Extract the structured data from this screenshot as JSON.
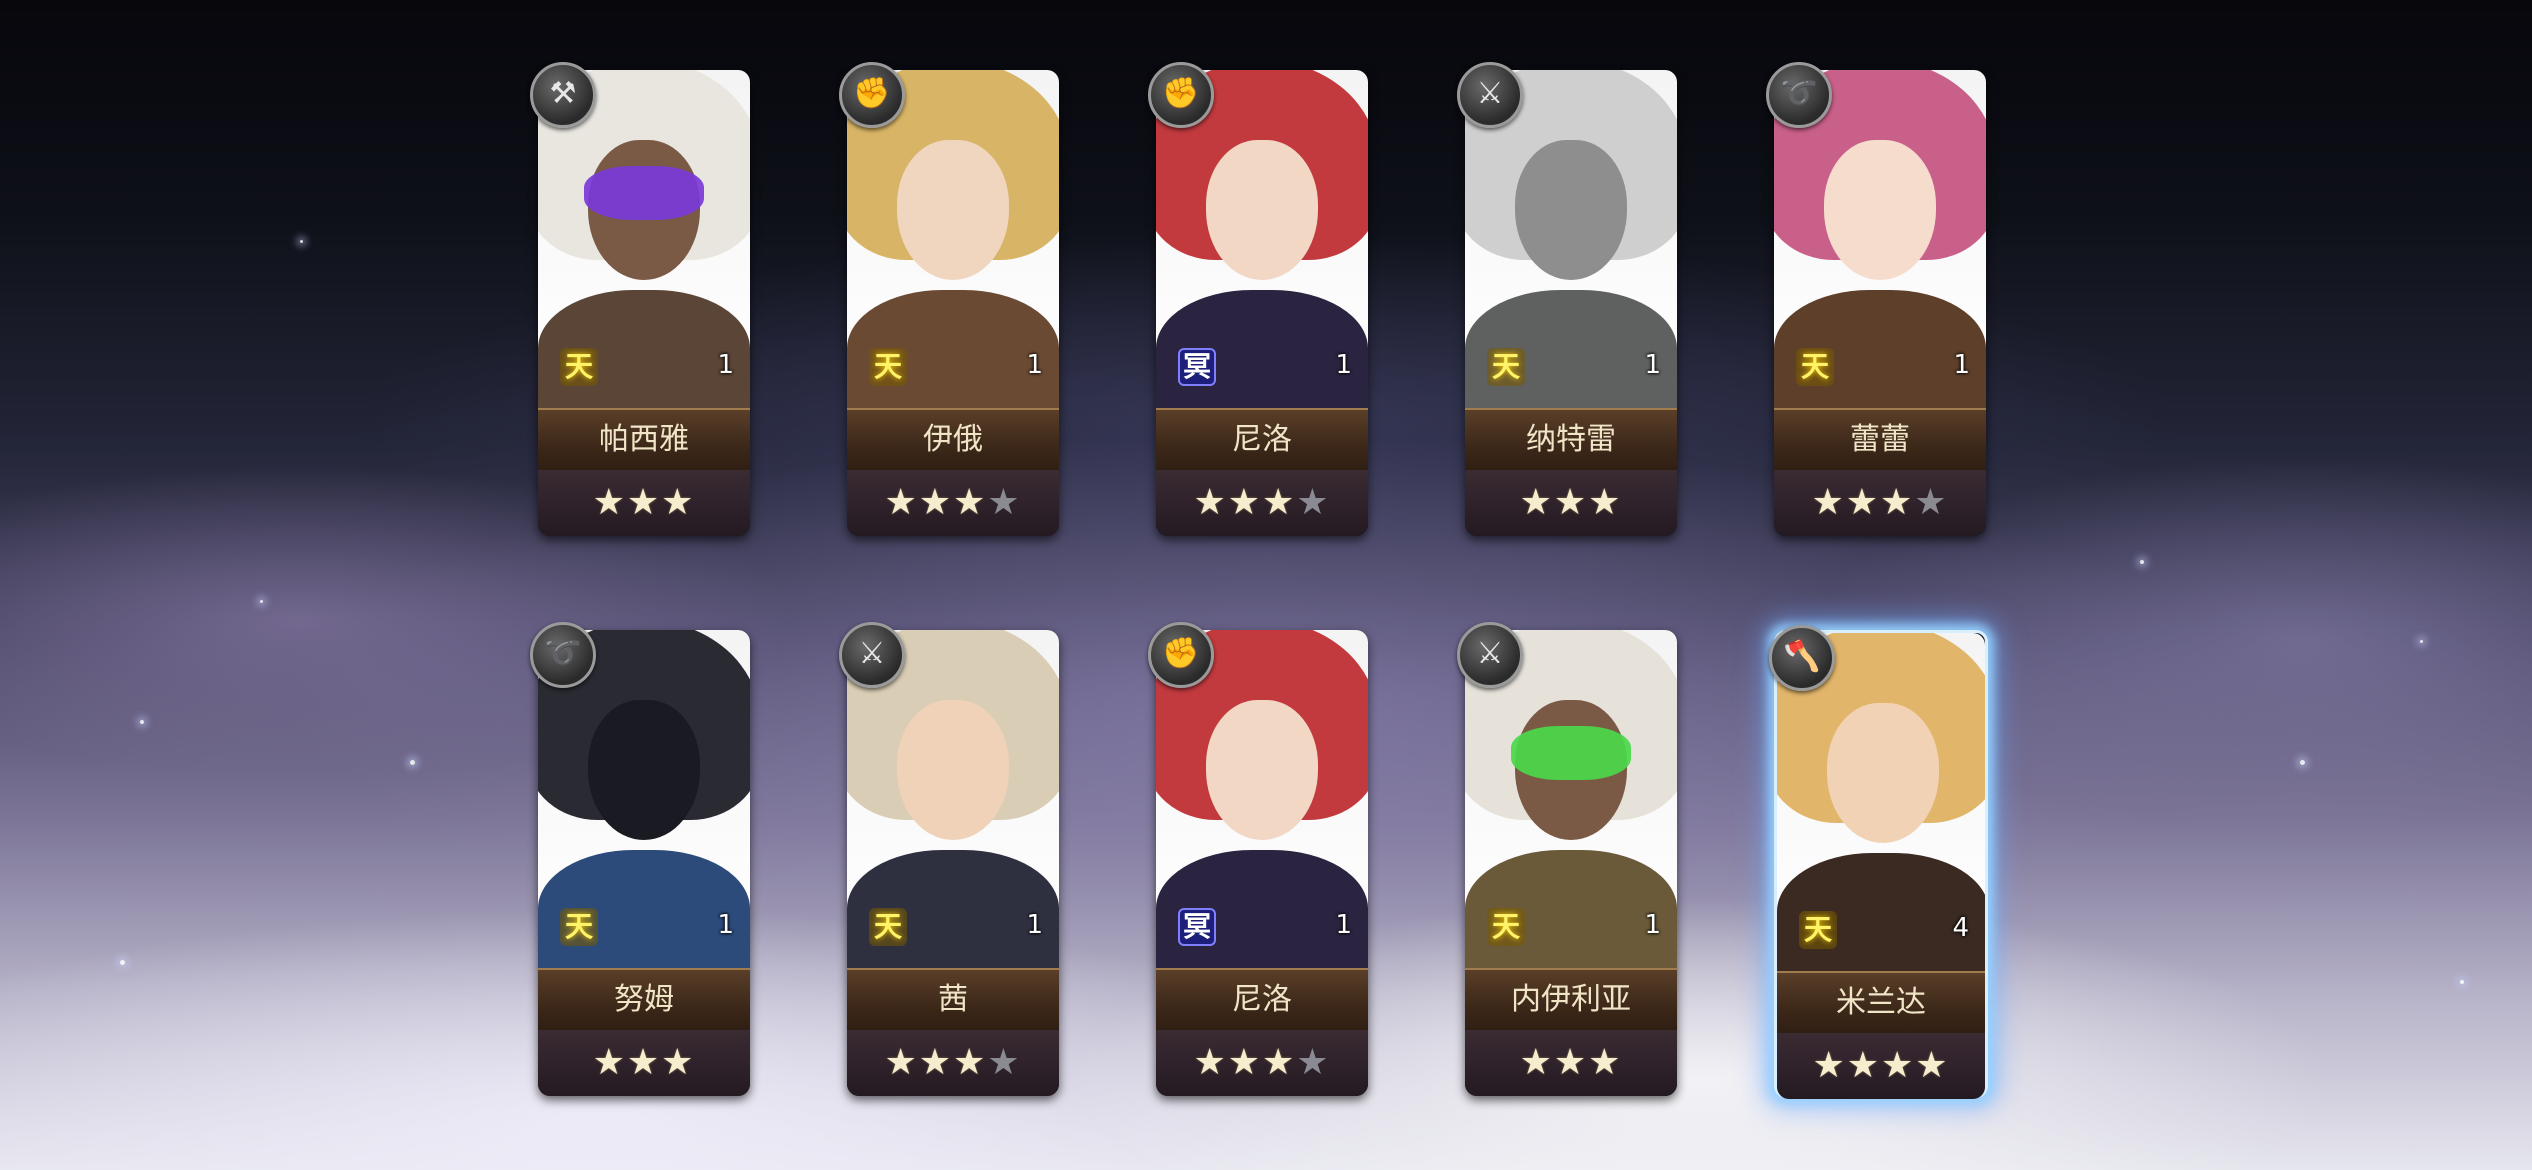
{
  "cards": [
    {
      "name": "帕西雅",
      "level": "1",
      "element": "天",
      "element_type": "sky",
      "weapon_icon": "hammer-icon",
      "weapon_glyph": "⚒",
      "stars": [
        "on",
        "on",
        "on"
      ],
      "hair": "#e9e6e0",
      "face": "#7a5a45",
      "body": "#5a4536",
      "mask": "#7a3ad8",
      "highlight": false
    },
    {
      "name": "伊俄",
      "level": "1",
      "element": "天",
      "element_type": "sky",
      "weapon_icon": "gauntlet-icon",
      "weapon_glyph": "✊",
      "stars": [
        "on",
        "on",
        "on",
        "off"
      ],
      "hair": "#d8b466",
      "face": "#f0d6bf",
      "body": "#6b4a33",
      "mask": "",
      "highlight": false
    },
    {
      "name": "尼洛",
      "level": "1",
      "element": "冥",
      "element_type": "dark",
      "weapon_icon": "gauntlet-icon",
      "weapon_glyph": "✊",
      "stars": [
        "on",
        "on",
        "on",
        "off"
      ],
      "hair": "#c23a3e",
      "face": "#f2d7c5",
      "body": "#2b2440",
      "mask": "",
      "highlight": false
    },
    {
      "name": "纳特雷",
      "level": "1",
      "element": "天",
      "element_type": "sky",
      "weapon_icon": "sword-icon",
      "weapon_glyph": "⚔",
      "stars": [
        "on",
        "on",
        "on"
      ],
      "hair": "#cfcfcf",
      "face": "#8e8e8e",
      "body": "#5f6060",
      "mask": "",
      "highlight": false
    },
    {
      "name": "蕾蕾",
      "level": "1",
      "element": "天",
      "element_type": "sky",
      "weapon_icon": "whip-icon",
      "weapon_glyph": "➰",
      "stars": [
        "on",
        "on",
        "on",
        "off"
      ],
      "hair": "#c9608a",
      "face": "#f6dccd",
      "body": "#5d3f2a",
      "mask": "",
      "highlight": false
    },
    {
      "name": "努姆",
      "level": "1",
      "element": "天",
      "element_type": "sky",
      "weapon_icon": "whip-icon",
      "weapon_glyph": "➰",
      "stars": [
        "on",
        "on",
        "on"
      ],
      "hair": "#2a2a33",
      "face": "#1a1a22",
      "body": "#2c4a7a",
      "mask": "",
      "highlight": false
    },
    {
      "name": "茜",
      "level": "1",
      "element": "天",
      "element_type": "sky",
      "weapon_icon": "sword-icon",
      "weapon_glyph": "⚔",
      "stars": [
        "on",
        "on",
        "on",
        "off"
      ],
      "hair": "#d9cdb5",
      "face": "#f0d2b8",
      "body": "#2e3040",
      "mask": "",
      "highlight": false
    },
    {
      "name": "尼洛",
      "level": "1",
      "element": "冥",
      "element_type": "dark",
      "weapon_icon": "gauntlet-icon",
      "weapon_glyph": "✊",
      "stars": [
        "on",
        "on",
        "on",
        "off"
      ],
      "hair": "#c23a3e",
      "face": "#f2d7c5",
      "body": "#2b2440",
      "mask": "",
      "highlight": false
    },
    {
      "name": "内伊利亚",
      "level": "1",
      "element": "天",
      "element_type": "sky",
      "weapon_icon": "sword-icon",
      "weapon_glyph": "⚔",
      "stars": [
        "on",
        "on",
        "on"
      ],
      "hair": "#e6e2da",
      "face": "#7a5a45",
      "body": "#6a5a3a",
      "mask": "#4ad84a",
      "highlight": false
    },
    {
      "name": "米兰达",
      "level": "4",
      "element": "天",
      "element_type": "sky",
      "weapon_icon": "axe-icon",
      "weapon_glyph": "🪓",
      "stars": [
        "on",
        "on",
        "on",
        "on"
      ],
      "hair": "#e1b56a",
      "face": "#f2d2b5",
      "body": "#3a2a22",
      "mask": "",
      "highlight": true
    }
  ]
}
